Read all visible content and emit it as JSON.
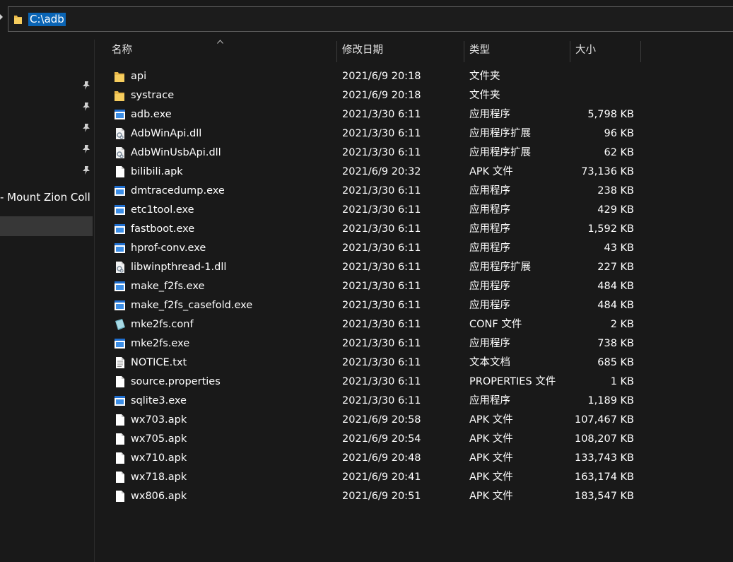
{
  "address": {
    "path": "C:\\adb"
  },
  "sidebar": {
    "partial_item_label": "- Mount Zion Coll"
  },
  "columns": {
    "name": "名称",
    "date": "修改日期",
    "type": "类型",
    "size": "大小"
  },
  "files": [
    {
      "name": "api",
      "date": "2021/6/9 20:18",
      "type": "文件夹",
      "size": "",
      "icon": "folder-icon"
    },
    {
      "name": "systrace",
      "date": "2021/6/9 20:18",
      "type": "文件夹",
      "size": "",
      "icon": "folder-icon"
    },
    {
      "name": "adb.exe",
      "date": "2021/3/30 6:11",
      "type": "应用程序",
      "size": "5,798 KB",
      "icon": "exe-icon"
    },
    {
      "name": "AdbWinApi.dll",
      "date": "2021/3/30 6:11",
      "type": "应用程序扩展",
      "size": "96 KB",
      "icon": "dll-icon"
    },
    {
      "name": "AdbWinUsbApi.dll",
      "date": "2021/3/30 6:11",
      "type": "应用程序扩展",
      "size": "62 KB",
      "icon": "dll-icon"
    },
    {
      "name": "bilibili.apk",
      "date": "2021/6/9 20:32",
      "type": "APK 文件",
      "size": "73,136 KB",
      "icon": "file-icon"
    },
    {
      "name": "dmtracedump.exe",
      "date": "2021/3/30 6:11",
      "type": "应用程序",
      "size": "238 KB",
      "icon": "exe-icon"
    },
    {
      "name": "etc1tool.exe",
      "date": "2021/3/30 6:11",
      "type": "应用程序",
      "size": "429 KB",
      "icon": "exe-icon"
    },
    {
      "name": "fastboot.exe",
      "date": "2021/3/30 6:11",
      "type": "应用程序",
      "size": "1,592 KB",
      "icon": "exe-icon"
    },
    {
      "name": "hprof-conv.exe",
      "date": "2021/3/30 6:11",
      "type": "应用程序",
      "size": "43 KB",
      "icon": "exe-icon"
    },
    {
      "name": "libwinpthread-1.dll",
      "date": "2021/3/30 6:11",
      "type": "应用程序扩展",
      "size": "227 KB",
      "icon": "dll-icon"
    },
    {
      "name": "make_f2fs.exe",
      "date": "2021/3/30 6:11",
      "type": "应用程序",
      "size": "484 KB",
      "icon": "exe-icon"
    },
    {
      "name": "make_f2fs_casefold.exe",
      "date": "2021/3/30 6:11",
      "type": "应用程序",
      "size": "484 KB",
      "icon": "exe-icon"
    },
    {
      "name": "mke2fs.conf",
      "date": "2021/3/30 6:11",
      "type": "CONF 文件",
      "size": "2 KB",
      "icon": "conf-icon"
    },
    {
      "name": "mke2fs.exe",
      "date": "2021/3/30 6:11",
      "type": "应用程序",
      "size": "738 KB",
      "icon": "exe-icon"
    },
    {
      "name": "NOTICE.txt",
      "date": "2021/3/30 6:11",
      "type": "文本文档",
      "size": "685 KB",
      "icon": "text-file-icon"
    },
    {
      "name": "source.properties",
      "date": "2021/3/30 6:11",
      "type": "PROPERTIES 文件",
      "size": "1 KB",
      "icon": "file-icon"
    },
    {
      "name": "sqlite3.exe",
      "date": "2021/3/30 6:11",
      "type": "应用程序",
      "size": "1,189 KB",
      "icon": "exe-icon"
    },
    {
      "name": "wx703.apk",
      "date": "2021/6/9 20:58",
      "type": "APK 文件",
      "size": "107,467 KB",
      "icon": "file-icon"
    },
    {
      "name": "wx705.apk",
      "date": "2021/6/9 20:54",
      "type": "APK 文件",
      "size": "108,207 KB",
      "icon": "file-icon"
    },
    {
      "name": "wx710.apk",
      "date": "2021/6/9 20:48",
      "type": "APK 文件",
      "size": "133,743 KB",
      "icon": "file-icon"
    },
    {
      "name": "wx718.apk",
      "date": "2021/6/9 20:41",
      "type": "APK 文件",
      "size": "163,174 KB",
      "icon": "file-icon"
    },
    {
      "name": "wx806.apk",
      "date": "2021/6/9 20:51",
      "type": "APK 文件",
      "size": "183,547 KB",
      "icon": "file-icon"
    }
  ]
}
